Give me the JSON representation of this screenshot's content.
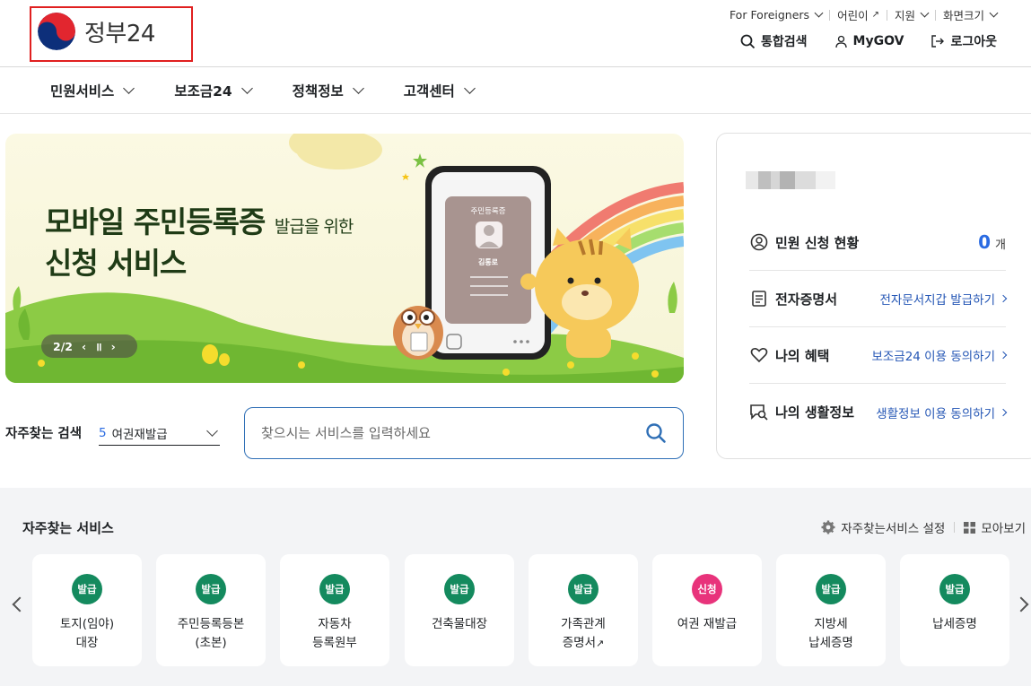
{
  "header": {
    "logo_text": "정부24",
    "util": [
      {
        "label": "For Foreigners",
        "icon": "chevron-down-icon"
      },
      {
        "label": "어린이",
        "icon": "external-link-icon"
      },
      {
        "label": "지원",
        "icon": "chevron-down-icon"
      },
      {
        "label": "화면크기",
        "icon": "chevron-down-icon"
      }
    ],
    "actions": [
      {
        "label": "통합검색",
        "icon": "search-icon"
      },
      {
        "label": "MyGOV",
        "icon": "user-icon"
      },
      {
        "label": "로그아웃",
        "icon": "logout-icon"
      }
    ]
  },
  "nav": [
    "민원서비스",
    "보조금24",
    "정책정보",
    "고객센터"
  ],
  "banner": {
    "title_main": "모바일 주민등록증",
    "title_small": "발급을 위한",
    "title_line2": "신청 서비스",
    "card_title": "주민등록증",
    "card_name": "김통로",
    "pager": "2/2"
  },
  "panel": {
    "rows": [
      {
        "label": "민원 신청 현황",
        "icon": "user-circle-icon",
        "count": "0",
        "unit": "개"
      },
      {
        "label": "전자증명서",
        "icon": "document-icon",
        "link": "전자문서지갑 발급하기"
      },
      {
        "label": "나의 혜택",
        "icon": "heart-icon",
        "link": "보조금24 이용 동의하기"
      },
      {
        "label": "나의 생활정보",
        "icon": "chat-search-icon",
        "link": "생활정보 이용 동의하기"
      }
    ]
  },
  "search": {
    "freq_label": "자주찾는 검색",
    "freq_num": "5",
    "freq_value": "여권재발급",
    "placeholder": "찾으시는 서비스를 입력하세요"
  },
  "services": {
    "title": "자주찾는 서비스",
    "settings": "자주찾는서비스 설정",
    "view_all": "모아보기",
    "cards": [
      {
        "badge": "발급",
        "label": "토지(임야)\n대장",
        "color": "#148a5e"
      },
      {
        "badge": "발급",
        "label": "주민등록등본\n(초본)",
        "color": "#148a5e"
      },
      {
        "badge": "발급",
        "label": "자동차\n등록원부",
        "color": "#148a5e"
      },
      {
        "badge": "발급",
        "label": "건축물대장",
        "color": "#148a5e"
      },
      {
        "badge": "발급",
        "label": "가족관계\n증명서",
        "color": "#148a5e",
        "external": true
      },
      {
        "badge": "신청",
        "label": "여권 재발급",
        "color": "#e8337b"
      },
      {
        "badge": "발급",
        "label": "지방세\n납세증명",
        "color": "#148a5e"
      },
      {
        "badge": "발급",
        "label": "납세증명",
        "color": "#148a5e"
      }
    ]
  },
  "colors": {
    "accent": "#2a6be2",
    "issue_badge": "#148a5e",
    "apply_badge": "#e8337b",
    "link": "#2456b5"
  }
}
